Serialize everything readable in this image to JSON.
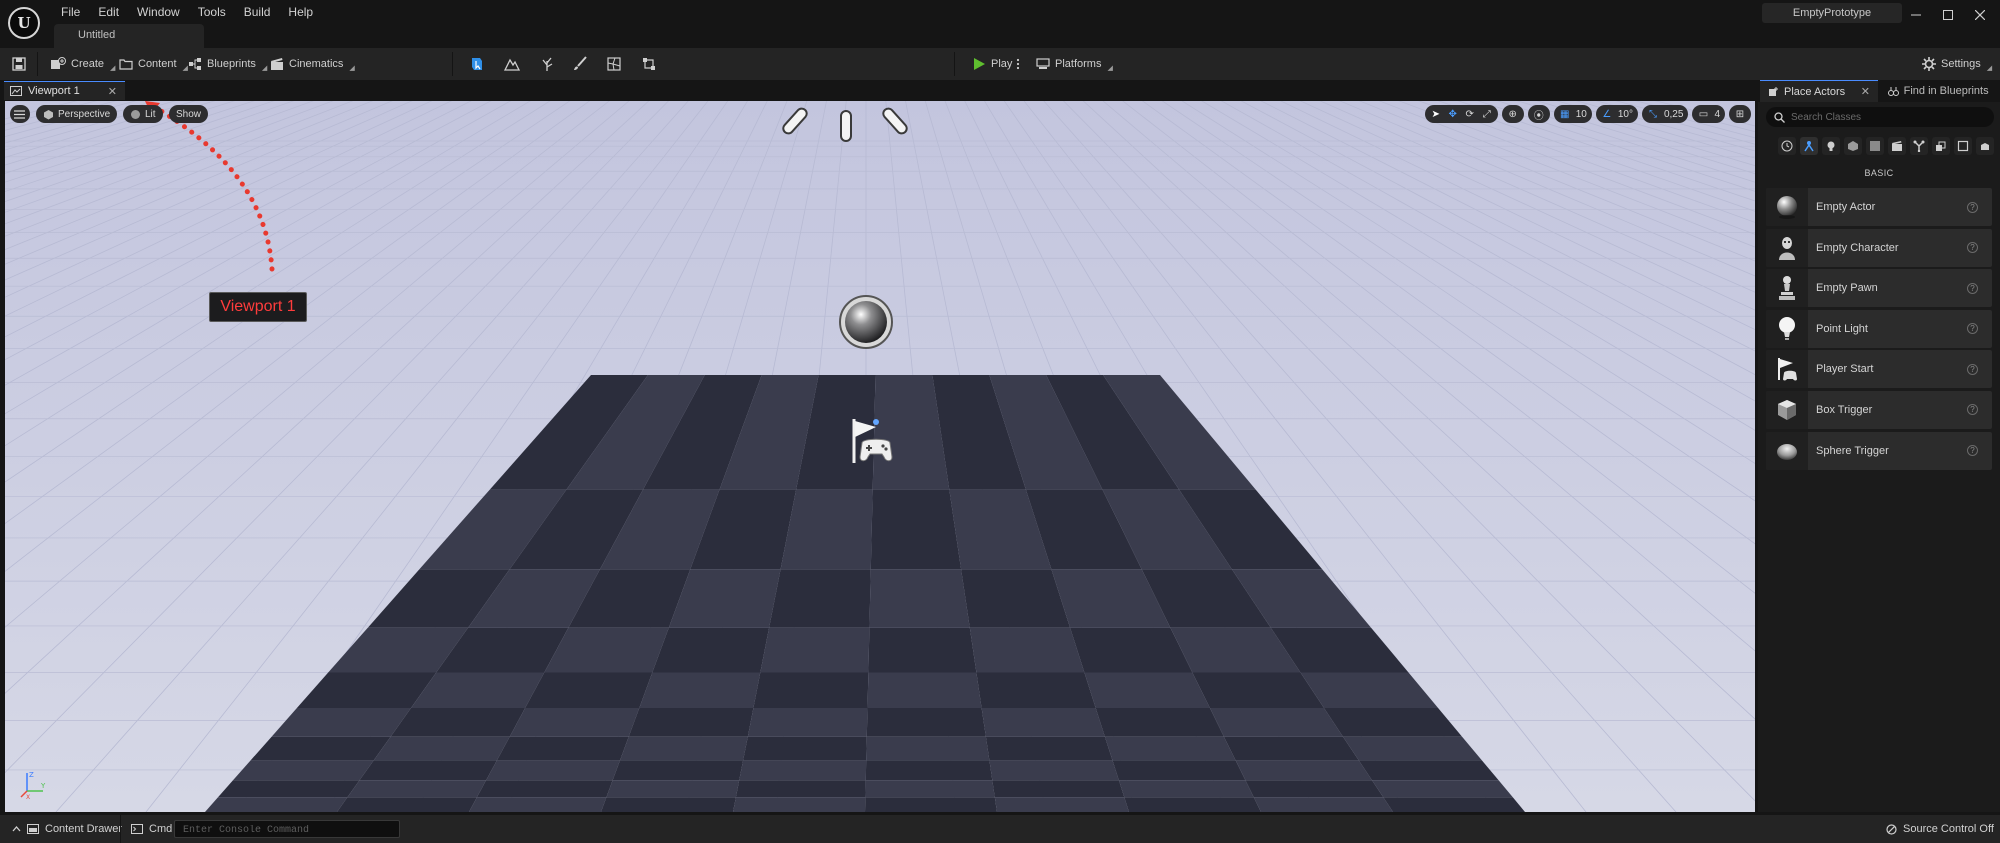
{
  "window": {
    "project_name": "EmptyPrototype",
    "doc_tab": "Untitled",
    "logo_text": "U"
  },
  "menu": [
    "File",
    "Edit",
    "Window",
    "Tools",
    "Build",
    "Help"
  ],
  "toolbar": {
    "create": "Create",
    "content": "Content",
    "blueprints": "Blueprints",
    "cinematics": "Cinematics",
    "play": "Play",
    "platforms": "Platforms",
    "settings": "Settings"
  },
  "viewport": {
    "tab_label": "Viewport 1",
    "view_mode": "Perspective",
    "lit_mode": "Lit",
    "show": "Show",
    "grid_snap": "10",
    "rotation_snap": "10°",
    "scale_snap": "0,25",
    "camera_speed": "4",
    "annotation_label": "Viewport 1",
    "axis_labels": {
      "x": "X",
      "y": "Y",
      "z": "Z"
    }
  },
  "right_panel": {
    "tabs": [
      "Place Actors",
      "Find in Blueprints"
    ],
    "search_placeholder": "Search Classes",
    "category_label": "BASIC",
    "actors": [
      {
        "name": "Empty Actor",
        "icon": "sphere-icon"
      },
      {
        "name": "Empty Character",
        "icon": "character-icon"
      },
      {
        "name": "Empty Pawn",
        "icon": "pawn-icon"
      },
      {
        "name": "Point Light",
        "icon": "lightbulb-icon"
      },
      {
        "name": "Player Start",
        "icon": "flag-icon"
      },
      {
        "name": "Box Trigger",
        "icon": "box-icon"
      },
      {
        "name": "Sphere Trigger",
        "icon": "sphere-trigger-icon"
      }
    ]
  },
  "statusbar": {
    "content_drawer": "Content Drawer",
    "cmd": "Cmd",
    "console_placeholder": "Enter Console Command",
    "source_control": "Source Control Off"
  },
  "colors": {
    "accent_blue": "#4a8cff",
    "play_green": "#5fbf2f",
    "annotation_red": "#e8392f",
    "floor_dark": "#2e3040",
    "sky": "#c9cbe0"
  }
}
